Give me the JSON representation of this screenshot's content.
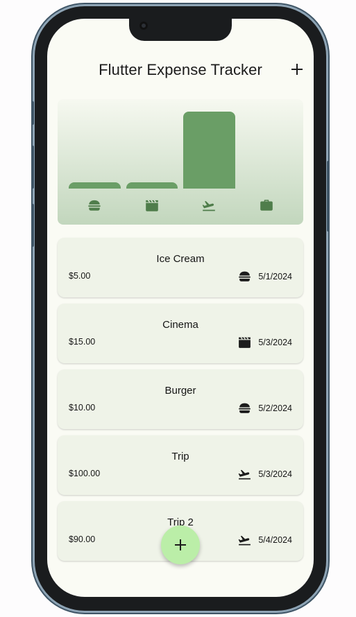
{
  "app_bar": {
    "title": "Flutter Expense Tracker",
    "add_icon": "plus-icon"
  },
  "chart": {
    "bar_color": "#6a9e66",
    "buckets": [
      {
        "category": "food",
        "icon": "burger-icon",
        "total": 15.0
      },
      {
        "category": "leisure",
        "icon": "clapperboard-icon",
        "total": 15.0
      },
      {
        "category": "travel",
        "icon": "flight-takeoff-icon",
        "total": 190.0
      },
      {
        "category": "work",
        "icon": "briefcase-icon",
        "total": 0.0
      }
    ]
  },
  "expenses": [
    {
      "title": "Ice Cream",
      "amount": "$5.00",
      "icon": "burger-icon",
      "date": "5/1/2024"
    },
    {
      "title": "Cinema",
      "amount": "$15.00",
      "icon": "clapperboard-icon",
      "date": "5/3/2024"
    },
    {
      "title": "Burger",
      "amount": "$10.00",
      "icon": "burger-icon",
      "date": "5/2/2024"
    },
    {
      "title": "Trip",
      "amount": "$100.00",
      "icon": "flight-takeoff-icon",
      "date": "5/3/2024"
    },
    {
      "title": "Trip 2",
      "amount": "$90.00",
      "icon": "flight-takeoff-icon",
      "date": "5/4/2024"
    }
  ],
  "fab": {
    "icon": "plus-icon",
    "color": "#bbeea8"
  }
}
